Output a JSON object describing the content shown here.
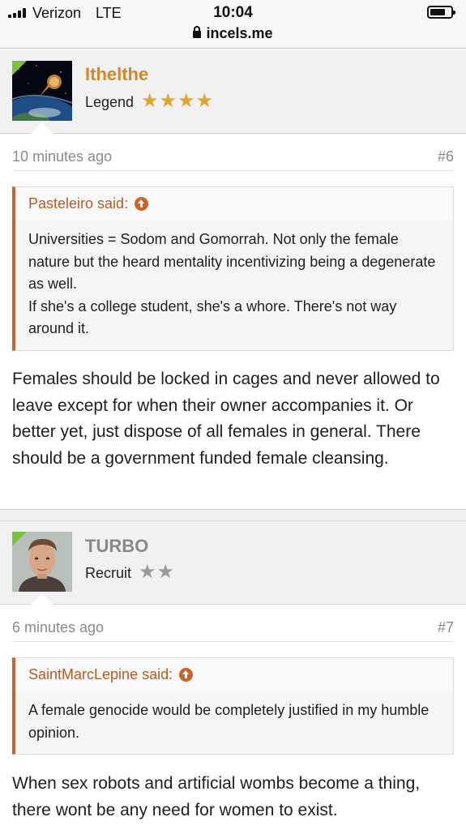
{
  "status_bar": {
    "carrier": "Verizon",
    "network": "LTE",
    "time": "10:04",
    "url": "incels.me"
  },
  "posts": [
    {
      "username": "Ithelthe",
      "username_color": "#d2882f",
      "rank": "Legend",
      "stars": "★★★★",
      "stars_color": "#e0a52f",
      "avatar_icon": "earth-meteor-avatar",
      "time": "10 minutes ago",
      "number": "#6",
      "quote_author": "Pasteleiro said:",
      "quote_lines": [
        "Universities = Sodom and Gomorrah. Not only the female nature but the heard mentality incentivizing being a degenerate as well.",
        "If she's a college student, she's a whore. There's not way around it."
      ],
      "body": "Females should be locked in cages and never allowed to leave except for when their owner accompanies it. Or better yet, just dispose of all females in general. There should be a government funded female cleansing."
    },
    {
      "username": "TURBO",
      "username_color": "#8a8a8a",
      "rank": "Recruit",
      "stars": "★★",
      "stars_color": "#9a9a9a",
      "avatar_icon": "man-portrait-avatar",
      "time": "6 minutes ago",
      "number": "#7",
      "quote_author": "SaintMarcLepine said:",
      "quote_lines": [
        "A female genocide would be completely justified in my humble opinion."
      ],
      "body": "When sex robots and artificial wombs become a thing, there wont be any need for women to exist."
    }
  ]
}
